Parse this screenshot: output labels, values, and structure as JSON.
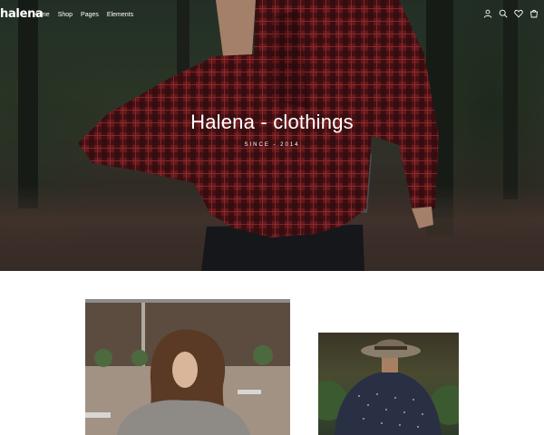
{
  "brand": {
    "logo": "halena"
  },
  "nav": {
    "items": [
      {
        "label": "Home"
      },
      {
        "label": "Shop"
      },
      {
        "label": "Pages"
      },
      {
        "label": "Elements"
      }
    ],
    "icons": [
      "user-icon",
      "search-icon",
      "heart-icon",
      "cart-icon"
    ]
  },
  "hero": {
    "title": "Halena - clothings",
    "subtitle": "SINCE - 2014"
  },
  "products": [
    {
      "image": "woman-with-long-hair-photo"
    },
    {
      "image": "man-in-hat-and-patterned-shirt-photo"
    }
  ],
  "colors": {
    "nav_text": "#ffffff",
    "page_bg": "#ffffff",
    "plaid_red": "#7a1f22"
  }
}
